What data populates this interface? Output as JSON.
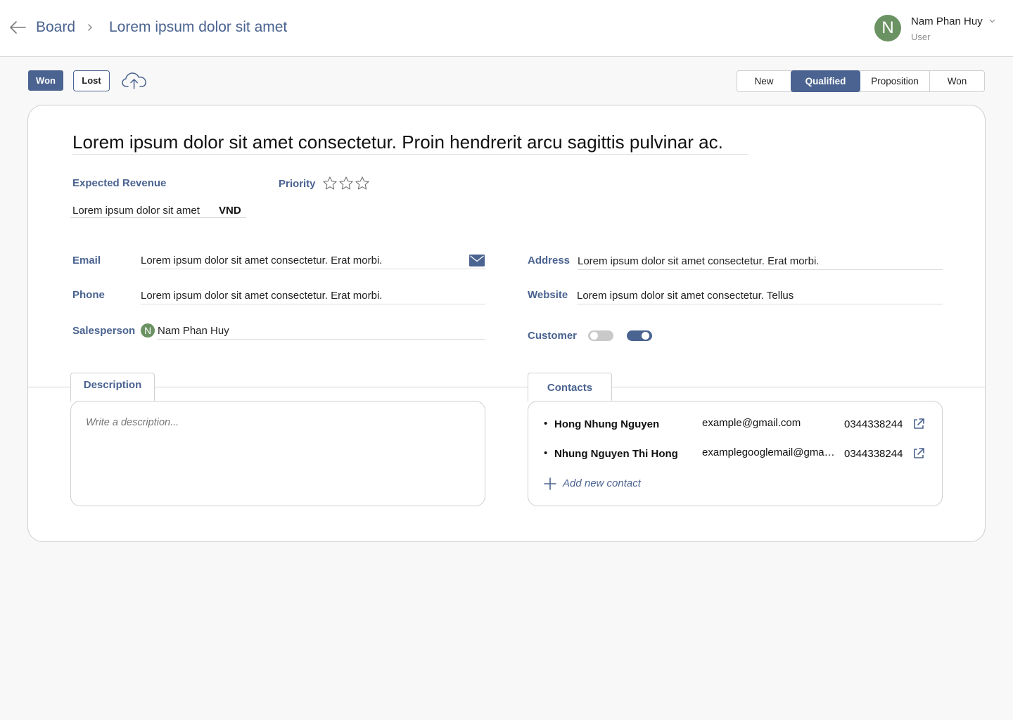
{
  "header": {
    "breadcrumb_root": "Board",
    "breadcrumb_current": "Lorem ipsum dolor sit amet",
    "user": {
      "initial": "N",
      "name": "Nam Phan Huy",
      "role": "User"
    }
  },
  "toolbar": {
    "won_label": "Won",
    "lost_label": "Lost"
  },
  "stages": {
    "items": [
      "New",
      "Qualified",
      "Proposition",
      "Won"
    ],
    "active": "Qualified"
  },
  "deal": {
    "title": "Lorem ipsum dolor sit amet consectetur. Proin hendrerit arcu sagittis pulvinar ac.",
    "expected_revenue_label": "Expected Revenue",
    "expected_revenue_value": "Lorem ipsum dolor sit amet",
    "currency": "VND",
    "priority_label": "Priority",
    "priority_stars": 0,
    "priority_max": 3,
    "email_label": "Email",
    "email_value": "Lorem ipsum dolor sit amet consectetur. Erat morbi.",
    "phone_label": "Phone",
    "phone_value": "Lorem ipsum dolor sit amet consectetur. Erat morbi.",
    "salesperson_label": "Salesperson",
    "salesperson_initial": "N",
    "salesperson_value": "Nam Phan Huy",
    "address_label": "Address",
    "address_value": "Lorem ipsum dolor sit amet consectetur. Erat morbi.",
    "website_label": "Website",
    "website_value": "Lorem ipsum dolor sit amet consectetur. Tellus",
    "customer_label": "Customer"
  },
  "tabs": {
    "description": "Description",
    "contacts": "Contacts"
  },
  "description": {
    "placeholder": "Write a description..."
  },
  "contacts": {
    "items": [
      {
        "name": "Hong Nhung Nguyen",
        "email": "example@gmail.com",
        "phone": "0344338244"
      },
      {
        "name": "Nhung Nguyen Thi Hong",
        "email": "examplegooglemail@gmail.com",
        "phone": "0344338244"
      }
    ],
    "add_label": "Add new contact"
  },
  "colors": {
    "accent": "#4a6390",
    "avatar": "#6b9262",
    "background": "#f8f8f8"
  },
  "icons": [
    "back-arrow-icon",
    "chevron-right-icon",
    "chevron-down-icon",
    "cloud-upload-icon",
    "star-icon",
    "mail-icon",
    "external-link-icon",
    "plus-icon"
  ]
}
